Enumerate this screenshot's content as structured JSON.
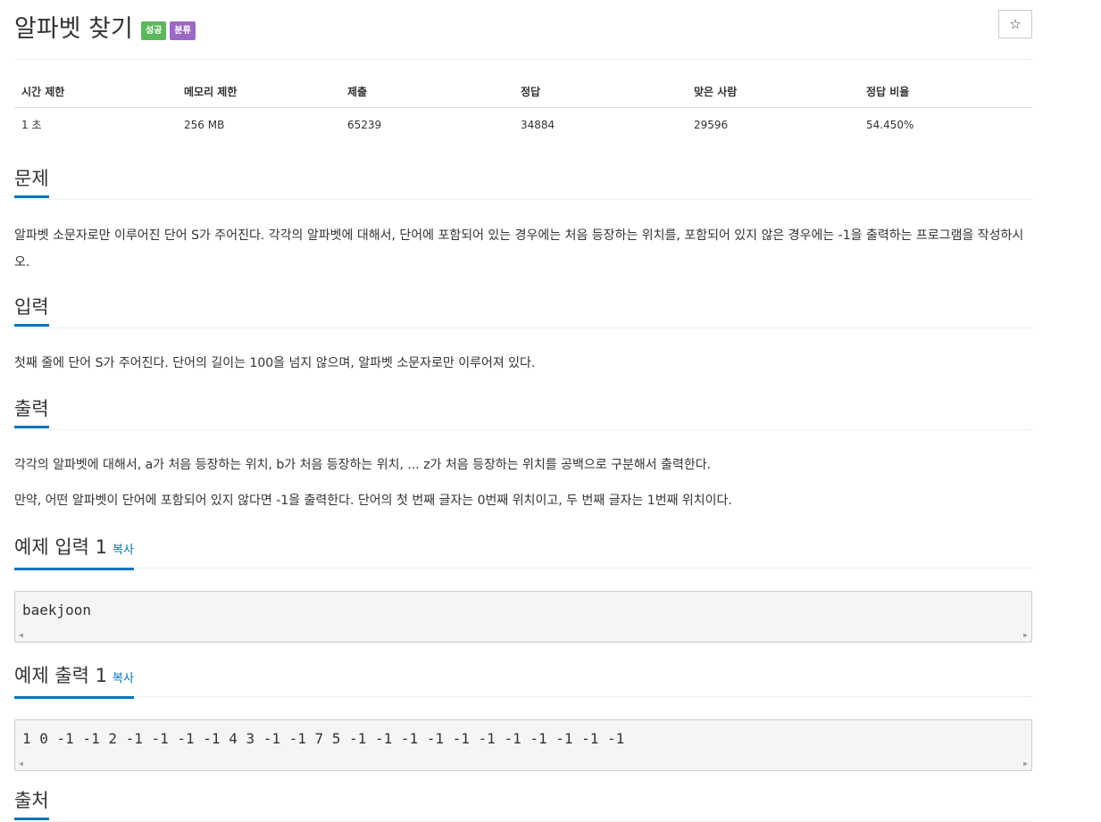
{
  "problem": {
    "title": "알파벳 찾기",
    "badges": [
      "성공",
      "분류"
    ],
    "star_icon": "☆"
  },
  "info_table": {
    "headers": [
      "시간 제한",
      "메모리 제한",
      "제출",
      "정답",
      "맞은 사람",
      "정답 비율"
    ],
    "values": [
      "1 초",
      "256 MB",
      "65239",
      "34884",
      "29596",
      "54.450%"
    ]
  },
  "sections": {
    "description": {
      "heading": "문제",
      "text": "알파벳 소문자로만 이루어진 단어 S가 주어진다. 각각의 알파벳에 대해서, 단어에 포함되어 있는 경우에는 처음 등장하는 위치를, 포함되어 있지 않은 경우에는 -1을 출력하는 프로그램을 작성하시오."
    },
    "input": {
      "heading": "입력",
      "text": "첫째 줄에 단어 S가 주어진다. 단어의 길이는 100을 넘지 않으며, 알파벳 소문자로만 이루어져 있다."
    },
    "output": {
      "heading": "출력",
      "line1": "각각의 알파벳에 대해서, a가 처음 등장하는 위치, b가 처음 등장하는 위치, ... z가 처음 등장하는 위치를 공백으로 구분해서 출력한다.",
      "line2": "만약, 어떤 알파벳이 단어에 포함되어 있지 않다면 -1을 출력한다. 단어의 첫 번째 글자는 0번째 위치이고, 두 번째 글자는 1번째 위치이다."
    },
    "sample_input": {
      "heading": "예제 입력 1",
      "copy": "복사",
      "content": "baekjoon"
    },
    "sample_output": {
      "heading": "예제 출력 1",
      "copy": "복사",
      "content": "1 0 -1 -1 2 -1 -1 -1 -1 4 3 -1 -1 7 5 -1 -1 -1 -1 -1 -1 -1 -1 -1 -1 -1"
    },
    "source": {
      "heading": "출처"
    }
  },
  "colors": {
    "accent": "#0076c0",
    "success_badge": "#5cb85c",
    "category_badge": "#9d68c7"
  }
}
